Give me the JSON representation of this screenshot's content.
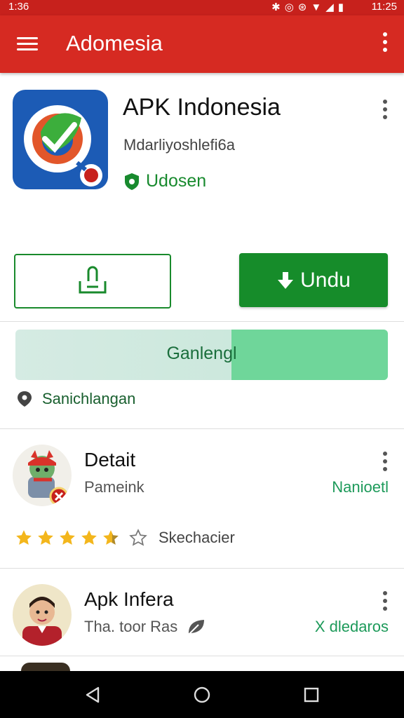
{
  "status_bar": {
    "time_left": "1:36",
    "time_right": "11:25"
  },
  "app_bar": {
    "title": "Adomesia"
  },
  "app": {
    "name": "APK Indonesia",
    "developer": "Mdarliyoshlefi6a",
    "badge": "Udosen"
  },
  "buttons": {
    "install_label": "Undu"
  },
  "progress": {
    "label": "Ganlengl",
    "value_fraction": 0.42
  },
  "location": {
    "label": "Sanichlangan"
  },
  "list": [
    {
      "title": "Detait",
      "subtitle": "Pameink",
      "status": "Nanioetl",
      "rating": 4.5,
      "rating_label": "Skechacier"
    },
    {
      "title": "Apk Infera",
      "subtitle": "Tha. toor Ras",
      "status": "X dledaros"
    }
  ],
  "colors": {
    "primary_red": "#d62a22",
    "accent_green": "#168c2a"
  }
}
